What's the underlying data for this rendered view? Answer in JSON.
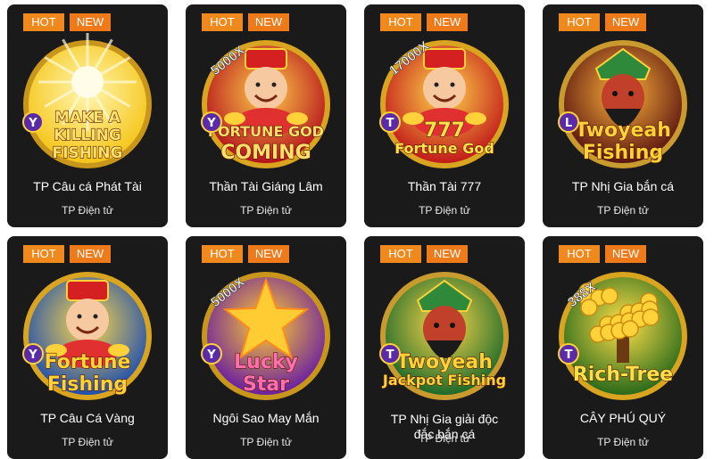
{
  "games": [
    {
      "title": "TP Câu cá Phát Tài",
      "provider": "TP Điện tử",
      "hot": "HOT",
      "new": "NEW",
      "logo_text": [
        "MAKE A",
        "KILLING",
        "FISHING"
      ],
      "multiplier": "",
      "platform_badge": "Y",
      "palette": {
        "bg": "#f5c518",
        "glow": "#fff6b0",
        "text": "#ffe26b",
        "ring": "#c9961c"
      },
      "icon": "sun-burst-icon"
    },
    {
      "title": "Thần Tài Giáng Lâm",
      "provider": "TP Điện tử",
      "hot": "HOT",
      "new": "NEW",
      "logo_text": [
        "FORTUNE GOD",
        "COMING"
      ],
      "multiplier": "5000X",
      "platform_badge": "Y",
      "palette": {
        "bg": "#b5121b",
        "glow": "#ffcf4a",
        "text": "#ffdf6a",
        "ring": "#d9a520"
      },
      "icon": "fortune-god-icon"
    },
    {
      "title": "Thần Tài 777",
      "provider": "TP Điện tử",
      "hot": "HOT",
      "new": "NEW",
      "logo_text": [
        "777",
        "Fortune God"
      ],
      "multiplier": "17000X",
      "platform_badge": "T",
      "palette": {
        "bg": "#c21a1a",
        "glow": "#ffd84a",
        "text": "#ffe14a",
        "ring": "#d9a520"
      },
      "icon": "fortune-god-icon"
    },
    {
      "title": "TP Nhị Gia bắn cá",
      "provider": "TP Điện tử",
      "hot": "HOT",
      "new": "NEW",
      "logo_text": [
        "Twoyeah",
        "Fishing"
      ],
      "multiplier": "",
      "platform_badge": "L",
      "palette": {
        "bg": "#5a1410",
        "glow": "#ffb43a",
        "text": "#ffd23a",
        "ring": "#c99a2e"
      },
      "icon": "warrior-icon"
    },
    {
      "title": "TP Câu Cá Vàng",
      "provider": "TP Điện tử",
      "hot": "HOT",
      "new": "NEW",
      "logo_text": [
        "Fortune",
        "Fishing"
      ],
      "multiplier": "",
      "platform_badge": "Y",
      "palette": {
        "bg": "#1e4fae",
        "glow": "#ffd84a",
        "text": "#ffd23a",
        "ring": "#d9a520"
      },
      "icon": "fortune-god-icon"
    },
    {
      "title": "Ngôi Sao May Mắn",
      "provider": "TP Điện tử",
      "hot": "HOT",
      "new": "NEW",
      "logo_text": [
        "Lucky",
        "Star"
      ],
      "multiplier": "5000X",
      "platform_badge": "Y",
      "palette": {
        "bg": "#6a1fa0",
        "glow": "#ffcc33",
        "text": "#ff6fb0",
        "ring": "#c9961c"
      },
      "icon": "star-icon"
    },
    {
      "title": "TP Nhị Gia giải độc đắc bắn cá",
      "provider": "TP Điện tử",
      "hot": "HOT",
      "new": "NEW",
      "logo_text": [
        "Twoyeah",
        "Jackpot Fishing"
      ],
      "multiplier": "",
      "platform_badge": "T",
      "palette": {
        "bg": "#1c6a2a",
        "glow": "#ffd84a",
        "text": "#ffd23a",
        "ring": "#c99a2e"
      },
      "icon": "warrior-icon"
    },
    {
      "title": "CÂY PHÚ QUÝ",
      "provider": "TP Điện tử",
      "hot": "HOT",
      "new": "NEW",
      "logo_text": [
        "Rich-Tree"
      ],
      "multiplier": "388X",
      "platform_badge": "T",
      "palette": {
        "bg": "#2a6a1a",
        "glow": "#ffe04a",
        "text": "#ffe04a",
        "ring": "#d9a520"
      },
      "icon": "money-tree-icon"
    }
  ]
}
